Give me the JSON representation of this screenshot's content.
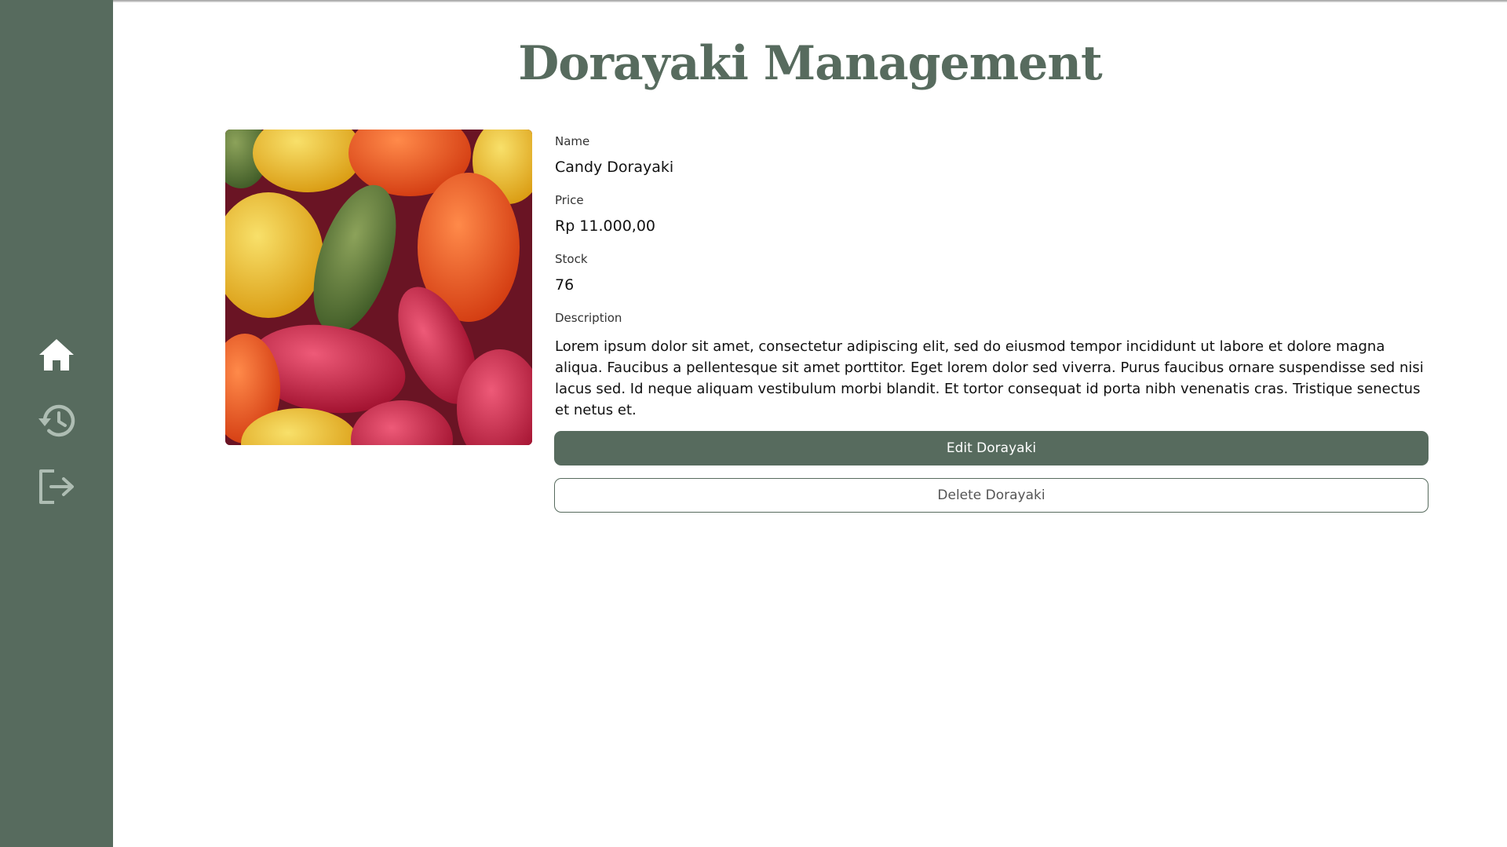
{
  "page": {
    "title": "Dorayaki Management"
  },
  "sidebar": {
    "icons": [
      "home-icon",
      "history-icon",
      "logout-icon"
    ],
    "background": "#576b5e"
  },
  "product": {
    "image": "candy-photo",
    "name_label": "Name",
    "name": "Candy Dorayaki",
    "price_label": "Price",
    "price": "Rp 11.000,00",
    "stock_label": "Stock",
    "stock": "76",
    "description_label": "Description",
    "description": "Lorem ipsum dolor sit amet, consectetur adipiscing elit, sed do eiusmod tempor incididunt ut labore et dolore magna aliqua. Faucibus a pellentesque sit amet porttitor. Eget lorem dolor sed viverra. Purus faucibus ornare suspendisse sed nisi lacus sed. Id neque aliquam vestibulum morbi blandit. Et tortor consequat id porta nibh venenatis cras. Tristique senectus et netus et."
  },
  "actions": {
    "edit_label": "Edit Dorayaki",
    "delete_label": "Delete Dorayaki"
  },
  "colors": {
    "accent": "#576b5e"
  }
}
